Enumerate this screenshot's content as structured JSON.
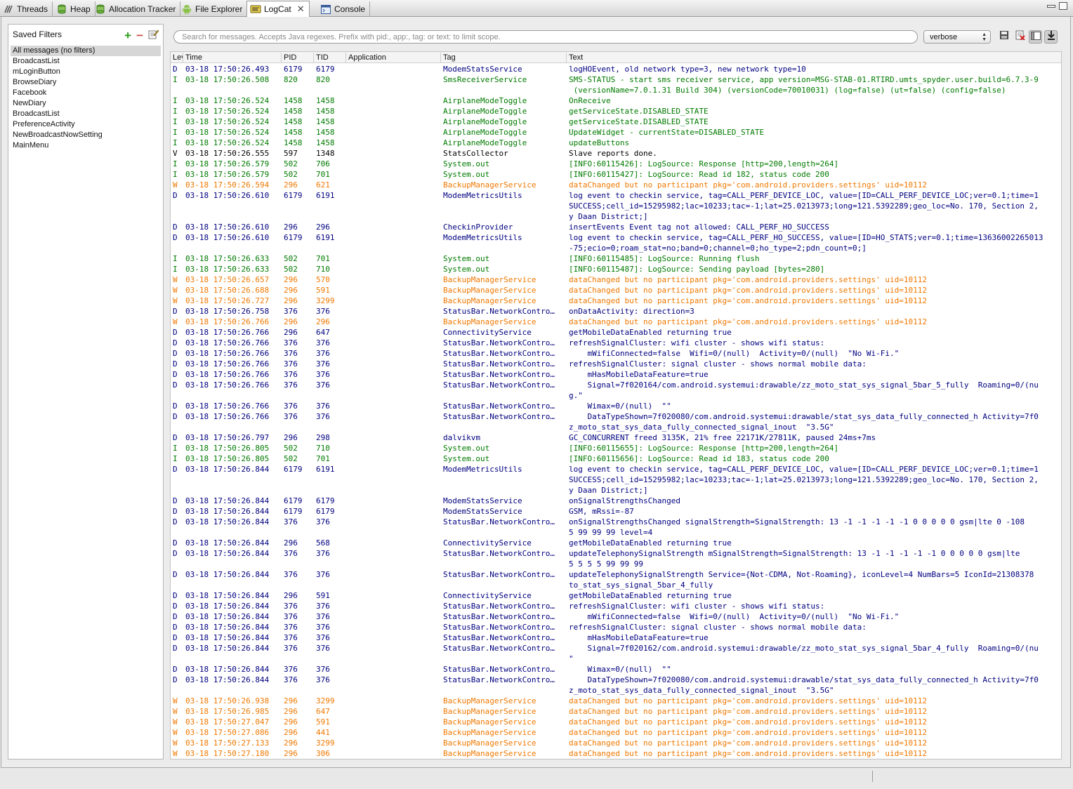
{
  "tabs": [
    {
      "label": "Threads",
      "icon": "threads-icon"
    },
    {
      "label": "Heap",
      "icon": "heap-icon"
    },
    {
      "label": "Allocation Tracker",
      "icon": "allocation-icon"
    },
    {
      "label": "File Explorer",
      "icon": "android-icon"
    },
    {
      "label": "LogCat",
      "icon": "logcat-icon",
      "active": true
    },
    {
      "label": "Console",
      "icon": "console-icon"
    }
  ],
  "filters": {
    "title": "Saved Filters",
    "items": [
      "All messages (no filters)",
      "BroadcastList",
      "mLoginButton",
      "BrowseDiary",
      "Facebook",
      "NewDiary",
      "BroadcastList",
      "PreferenceActivity",
      "NewBroadcastNowSetting",
      "MainMenu"
    ],
    "selected_index": 0
  },
  "search": {
    "placeholder": "Search for messages. Accepts Java regexes. Prefix with pid:, app:, tag: or text: to limit scope.",
    "value": ""
  },
  "level": {
    "value": "verbose"
  },
  "columns": [
    "Level",
    "Time",
    "PID",
    "TID",
    "Application",
    "Tag",
    "Text"
  ],
  "colors": {
    "D": "#000080",
    "I": "#007a00",
    "W": "#f07800",
    "V": "#000000"
  },
  "rows": [
    {
      "lvl": "D",
      "time": "03-18 17:50:26.493",
      "pid": "6179",
      "tid": "6179",
      "app": "",
      "tag": "ModemStatsService",
      "text": "logHOEvent, old network type=3, new network type=10"
    },
    {
      "lvl": "I",
      "time": "03-18 17:50:26.508",
      "pid": "820",
      "tid": "820",
      "app": "",
      "tag": "SmsReceiverService",
      "text": "SMS-STATUS - start sms receiver service, app version=MSG-STAB-01.RTIRD.umts_spyder.user.build=6.7.3-9"
    },
    {
      "lvl": "",
      "time": "",
      "pid": "",
      "tid": "",
      "app": "",
      "tag": "",
      "text": " (versionName=7.0.1.31 Build 304) (versionCode=70010031) (log=false) (ut=false) (config=false)",
      "cont": "I"
    },
    {
      "lvl": "I",
      "time": "03-18 17:50:26.524",
      "pid": "1458",
      "tid": "1458",
      "app": "",
      "tag": "AirplaneModeToggle",
      "text": "OnReceive"
    },
    {
      "lvl": "I",
      "time": "03-18 17:50:26.524",
      "pid": "1458",
      "tid": "1458",
      "app": "",
      "tag": "AirplaneModeToggle",
      "text": "getServiceState.DISABLED_STATE"
    },
    {
      "lvl": "I",
      "time": "03-18 17:50:26.524",
      "pid": "1458",
      "tid": "1458",
      "app": "",
      "tag": "AirplaneModeToggle",
      "text": "getServiceState.DISABLED_STATE"
    },
    {
      "lvl": "I",
      "time": "03-18 17:50:26.524",
      "pid": "1458",
      "tid": "1458",
      "app": "",
      "tag": "AirplaneModeToggle",
      "text": "UpdateWidget - currentState=DISABLED_STATE"
    },
    {
      "lvl": "I",
      "time": "03-18 17:50:26.524",
      "pid": "1458",
      "tid": "1458",
      "app": "",
      "tag": "AirplaneModeToggle",
      "text": "updateButtons"
    },
    {
      "lvl": "V",
      "time": "03-18 17:50:26.555",
      "pid": "597",
      "tid": "1348",
      "app": "",
      "tag": "StatsCollector",
      "text": "Slave reports done."
    },
    {
      "lvl": "I",
      "time": "03-18 17:50:26.579",
      "pid": "502",
      "tid": "706",
      "app": "",
      "tag": "System.out",
      "text": "[INFO:60115426]: LogSource: Response [http=200,length=264]"
    },
    {
      "lvl": "I",
      "time": "03-18 17:50:26.579",
      "pid": "502",
      "tid": "701",
      "app": "",
      "tag": "System.out",
      "text": "[INFO:60115427]: LogSource: Read id 182, status code 200"
    },
    {
      "lvl": "W",
      "time": "03-18 17:50:26.594",
      "pid": "296",
      "tid": "621",
      "app": "",
      "tag": "BackupManagerService",
      "text": "dataChanged but no participant pkg='com.android.providers.settings' uid=10112"
    },
    {
      "lvl": "D",
      "time": "03-18 17:50:26.610",
      "pid": "6179",
      "tid": "6191",
      "app": "",
      "tag": "ModemMetricsUtils",
      "text": "log event to checkin service, tag=CALL_PERF_DEVICE_LOC, value=[ID=CALL_PERF_DEVICE_LOC;ver=0.1;time=1"
    },
    {
      "lvl": "",
      "time": "",
      "pid": "",
      "tid": "",
      "app": "",
      "tag": "",
      "text": "SUCCESS;cell_id=15295982;lac=10233;tac=-1;lat=25.0213973;long=121.5392289;geo_loc=No. 170, Section 2,",
      "cont": "D"
    },
    {
      "lvl": "",
      "time": "",
      "pid": "",
      "tid": "",
      "app": "",
      "tag": "",
      "text": "y Daan District;]",
      "cont": "D"
    },
    {
      "lvl": "D",
      "time": "03-18 17:50:26.610",
      "pid": "296",
      "tid": "296",
      "app": "",
      "tag": "CheckinProvider",
      "text": "insertEvents Event tag not allowed: CALL_PERF_HO_SUCCESS"
    },
    {
      "lvl": "D",
      "time": "03-18 17:50:26.610",
      "pid": "6179",
      "tid": "6191",
      "app": "",
      "tag": "ModemMetricsUtils",
      "text": "log event to checkin service, tag=CALL_PERF_HO_SUCCESS, value=[ID=HO_STATS;ver=0.1;time=13636002265013"
    },
    {
      "lvl": "",
      "time": "",
      "pid": "",
      "tid": "",
      "app": "",
      "tag": "",
      "text": "-75;ecio=0;roam_stat=no;band=0;channel=0;ho_type=2;pdn_count=0;]",
      "cont": "D"
    },
    {
      "lvl": "I",
      "time": "03-18 17:50:26.633",
      "pid": "502",
      "tid": "701",
      "app": "",
      "tag": "System.out",
      "text": "[INFO:60115485]: LogSource: Running flush"
    },
    {
      "lvl": "I",
      "time": "03-18 17:50:26.633",
      "pid": "502",
      "tid": "710",
      "app": "",
      "tag": "System.out",
      "text": "[INFO:60115487]: LogSource: Sending payload [bytes=280]"
    },
    {
      "lvl": "W",
      "time": "03-18 17:50:26.657",
      "pid": "296",
      "tid": "570",
      "app": "",
      "tag": "BackupManagerService",
      "text": "dataChanged but no participant pkg='com.android.providers.settings' uid=10112"
    },
    {
      "lvl": "W",
      "time": "03-18 17:50:26.688",
      "pid": "296",
      "tid": "591",
      "app": "",
      "tag": "BackupManagerService",
      "text": "dataChanged but no participant pkg='com.android.providers.settings' uid=10112"
    },
    {
      "lvl": "W",
      "time": "03-18 17:50:26.727",
      "pid": "296",
      "tid": "3299",
      "app": "",
      "tag": "BackupManagerService",
      "text": "dataChanged but no participant pkg='com.android.providers.settings' uid=10112"
    },
    {
      "lvl": "D",
      "time": "03-18 17:50:26.758",
      "pid": "376",
      "tid": "376",
      "app": "",
      "tag": "StatusBar.NetworkContro…",
      "text": "onDataActivity: direction=3"
    },
    {
      "lvl": "W",
      "time": "03-18 17:50:26.766",
      "pid": "296",
      "tid": "296",
      "app": "",
      "tag": "BackupManagerService",
      "text": "dataChanged but no participant pkg='com.android.providers.settings' uid=10112"
    },
    {
      "lvl": "D",
      "time": "03-18 17:50:26.766",
      "pid": "296",
      "tid": "647",
      "app": "",
      "tag": "ConnectivityService",
      "text": "getMobileDataEnabled returning true"
    },
    {
      "lvl": "D",
      "time": "03-18 17:50:26.766",
      "pid": "376",
      "tid": "376",
      "app": "",
      "tag": "StatusBar.NetworkContro…",
      "text": "refreshSignalCluster: wifi cluster - shows wifi status:"
    },
    {
      "lvl": "D",
      "time": "03-18 17:50:26.766",
      "pid": "376",
      "tid": "376",
      "app": "",
      "tag": "StatusBar.NetworkContro…",
      "text": "    mWifiConnected=false  Wifi=0/(null)  Activity=0/(null)  \"No Wi-Fi.\""
    },
    {
      "lvl": "D",
      "time": "03-18 17:50:26.766",
      "pid": "376",
      "tid": "376",
      "app": "",
      "tag": "StatusBar.NetworkContro…",
      "text": "refreshSignalCluster: signal cluster - shows normal mobile data:"
    },
    {
      "lvl": "D",
      "time": "03-18 17:50:26.766",
      "pid": "376",
      "tid": "376",
      "app": "",
      "tag": "StatusBar.NetworkContro…",
      "text": "    mHasMobileDataFeature=true"
    },
    {
      "lvl": "D",
      "time": "03-18 17:50:26.766",
      "pid": "376",
      "tid": "376",
      "app": "",
      "tag": "StatusBar.NetworkContro…",
      "text": "    Signal=7f020164/com.android.systemui:drawable/zz_moto_stat_sys_signal_5bar_5_fully  Roaming=0/(nu"
    },
    {
      "lvl": "",
      "time": "",
      "pid": "",
      "tid": "",
      "app": "",
      "tag": "",
      "text": "g.\"",
      "cont": "D"
    },
    {
      "lvl": "D",
      "time": "03-18 17:50:26.766",
      "pid": "376",
      "tid": "376",
      "app": "",
      "tag": "StatusBar.NetworkContro…",
      "text": "    Wimax=0/(null)  \"\""
    },
    {
      "lvl": "D",
      "time": "03-18 17:50:26.766",
      "pid": "376",
      "tid": "376",
      "app": "",
      "tag": "StatusBar.NetworkContro…",
      "text": "    DataTypeShown=7f020080/com.android.systemui:drawable/stat_sys_data_fully_connected_h Activity=7f0"
    },
    {
      "lvl": "",
      "time": "",
      "pid": "",
      "tid": "",
      "app": "",
      "tag": "",
      "text": "z_moto_stat_sys_data_fully_connected_signal_inout  \"3.5G\"",
      "cont": "D"
    },
    {
      "lvl": "D",
      "time": "03-18 17:50:26.797",
      "pid": "296",
      "tid": "298",
      "app": "",
      "tag": "dalvikvm",
      "text": "GC_CONCURRENT freed 3135K, 21% free 22171K/27811K, paused 24ms+7ms"
    },
    {
      "lvl": "I",
      "time": "03-18 17:50:26.805",
      "pid": "502",
      "tid": "710",
      "app": "",
      "tag": "System.out",
      "text": "[INFO:60115655]: LogSource: Response [http=200,length=264]"
    },
    {
      "lvl": "I",
      "time": "03-18 17:50:26.805",
      "pid": "502",
      "tid": "701",
      "app": "",
      "tag": "System.out",
      "text": "[INFO:60115656]: LogSource: Read id 183, status code 200"
    },
    {
      "lvl": "D",
      "time": "03-18 17:50:26.844",
      "pid": "6179",
      "tid": "6191",
      "app": "",
      "tag": "ModemMetricsUtils",
      "text": "log event to checkin service, tag=CALL_PERF_DEVICE_LOC, value=[ID=CALL_PERF_DEVICE_LOC;ver=0.1;time=1"
    },
    {
      "lvl": "",
      "time": "",
      "pid": "",
      "tid": "",
      "app": "",
      "tag": "",
      "text": "SUCCESS;cell_id=15295982;lac=10233;tac=-1;lat=25.0213973;long=121.5392289;geo_loc=No. 170, Section 2,",
      "cont": "D"
    },
    {
      "lvl": "",
      "time": "",
      "pid": "",
      "tid": "",
      "app": "",
      "tag": "",
      "text": "y Daan District;]",
      "cont": "D"
    },
    {
      "lvl": "D",
      "time": "03-18 17:50:26.844",
      "pid": "6179",
      "tid": "6179",
      "app": "",
      "tag": "ModemStatsService",
      "text": "onSignalStrengthsChanged"
    },
    {
      "lvl": "D",
      "time": "03-18 17:50:26.844",
      "pid": "6179",
      "tid": "6179",
      "app": "",
      "tag": "ModemStatsService",
      "text": "GSM, mRssi=-87"
    },
    {
      "lvl": "D",
      "time": "03-18 17:50:26.844",
      "pid": "376",
      "tid": "376",
      "app": "",
      "tag": "StatusBar.NetworkContro…",
      "text": "onSignalStrengthsChanged signalStrength=SignalStrength: 13 -1 -1 -1 -1 -1 0 0 0 0 0 gsm|lte 0 -108"
    },
    {
      "lvl": "",
      "time": "",
      "pid": "",
      "tid": "",
      "app": "",
      "tag": "",
      "text": "5 99 99 99 level=4",
      "cont": "D"
    },
    {
      "lvl": "D",
      "time": "03-18 17:50:26.844",
      "pid": "296",
      "tid": "568",
      "app": "",
      "tag": "ConnectivityService",
      "text": "getMobileDataEnabled returning true"
    },
    {
      "lvl": "D",
      "time": "03-18 17:50:26.844",
      "pid": "376",
      "tid": "376",
      "app": "",
      "tag": "StatusBar.NetworkContro…",
      "text": "updateTelephonySignalStrength mSignalStrength=SignalStrength: 13 -1 -1 -1 -1 -1 0 0 0 0 0 gsm|lte"
    },
    {
      "lvl": "",
      "time": "",
      "pid": "",
      "tid": "",
      "app": "",
      "tag": "",
      "text": "5 5 5 5 99 99 99",
      "cont": "D"
    },
    {
      "lvl": "D",
      "time": "03-18 17:50:26.844",
      "pid": "376",
      "tid": "376",
      "app": "",
      "tag": "StatusBar.NetworkContro…",
      "text": "updateTelephonySignalStrength Service={Not-CDMA, Not-Roaming}, iconLevel=4 NumBars=5 IconId=21308378"
    },
    {
      "lvl": "",
      "time": "",
      "pid": "",
      "tid": "",
      "app": "",
      "tag": "",
      "text": "to_stat_sys_signal_5bar_4_fully",
      "cont": "D"
    },
    {
      "lvl": "D",
      "time": "03-18 17:50:26.844",
      "pid": "296",
      "tid": "591",
      "app": "",
      "tag": "ConnectivityService",
      "text": "getMobileDataEnabled returning true"
    },
    {
      "lvl": "D",
      "time": "03-18 17:50:26.844",
      "pid": "376",
      "tid": "376",
      "app": "",
      "tag": "StatusBar.NetworkContro…",
      "text": "refreshSignalCluster: wifi cluster - shows wifi status:"
    },
    {
      "lvl": "D",
      "time": "03-18 17:50:26.844",
      "pid": "376",
      "tid": "376",
      "app": "",
      "tag": "StatusBar.NetworkContro…",
      "text": "    mWifiConnected=false  Wifi=0/(null)  Activity=0/(null)  \"No Wi-Fi.\""
    },
    {
      "lvl": "D",
      "time": "03-18 17:50:26.844",
      "pid": "376",
      "tid": "376",
      "app": "",
      "tag": "StatusBar.NetworkContro…",
      "text": "refreshSignalCluster: signal cluster - shows normal mobile data:"
    },
    {
      "lvl": "D",
      "time": "03-18 17:50:26.844",
      "pid": "376",
      "tid": "376",
      "app": "",
      "tag": "StatusBar.NetworkContro…",
      "text": "    mHasMobileDataFeature=true"
    },
    {
      "lvl": "D",
      "time": "03-18 17:50:26.844",
      "pid": "376",
      "tid": "376",
      "app": "",
      "tag": "StatusBar.NetworkContro…",
      "text": "    Signal=7f020162/com.android.systemui:drawable/zz_moto_stat_sys_signal_5bar_4_fully  Roaming=0/(nu"
    },
    {
      "lvl": "",
      "time": "",
      "pid": "",
      "tid": "",
      "app": "",
      "tag": "",
      "text": "\"",
      "cont": "D"
    },
    {
      "lvl": "D",
      "time": "03-18 17:50:26.844",
      "pid": "376",
      "tid": "376",
      "app": "",
      "tag": "StatusBar.NetworkContro…",
      "text": "    Wimax=0/(null)  \"\""
    },
    {
      "lvl": "D",
      "time": "03-18 17:50:26.844",
      "pid": "376",
      "tid": "376",
      "app": "",
      "tag": "StatusBar.NetworkContro…",
      "text": "    DataTypeShown=7f020080/com.android.systemui:drawable/stat_sys_data_fully_connected_h Activity=7f0"
    },
    {
      "lvl": "",
      "time": "",
      "pid": "",
      "tid": "",
      "app": "",
      "tag": "",
      "text": "z_moto_stat_sys_data_fully_connected_signal_inout  \"3.5G\"",
      "cont": "D"
    },
    {
      "lvl": "W",
      "time": "03-18 17:50:26.938",
      "pid": "296",
      "tid": "3299",
      "app": "",
      "tag": "BackupManagerService",
      "text": "dataChanged but no participant pkg='com.android.providers.settings' uid=10112"
    },
    {
      "lvl": "W",
      "time": "03-18 17:50:26.985",
      "pid": "296",
      "tid": "647",
      "app": "",
      "tag": "BackupManagerService",
      "text": "dataChanged but no participant pkg='com.android.providers.settings' uid=10112"
    },
    {
      "lvl": "W",
      "time": "03-18 17:50:27.047",
      "pid": "296",
      "tid": "591",
      "app": "",
      "tag": "BackupManagerService",
      "text": "dataChanged but no participant pkg='com.android.providers.settings' uid=10112"
    },
    {
      "lvl": "W",
      "time": "03-18 17:50:27.086",
      "pid": "296",
      "tid": "441",
      "app": "",
      "tag": "BackupManagerService",
      "text": "dataChanged but no participant pkg='com.android.providers.settings' uid=10112"
    },
    {
      "lvl": "W",
      "time": "03-18 17:50:27.133",
      "pid": "296",
      "tid": "3299",
      "app": "",
      "tag": "BackupManagerService",
      "text": "dataChanged but no participant pkg='com.android.providers.settings' uid=10112"
    },
    {
      "lvl": "W",
      "time": "03-18 17:50:27.180",
      "pid": "296",
      "tid": "306",
      "app": "",
      "tag": "BackupManagerService",
      "text": "dataChanged but no participant pkg='com.android.providers.settings' uid=10112"
    }
  ]
}
